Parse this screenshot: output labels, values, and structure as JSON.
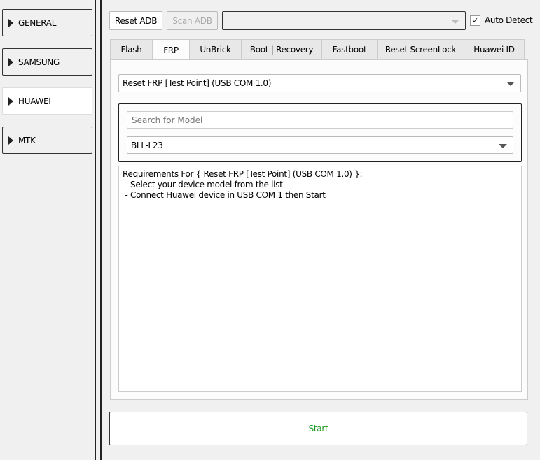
{
  "sidebar": {
    "items": [
      {
        "label": "GENERAL",
        "active": false
      },
      {
        "label": "SAMSUNG",
        "active": false
      },
      {
        "label": "HUAWEI",
        "active": true
      },
      {
        "label": "MTK",
        "active": false
      }
    ]
  },
  "toolbar": {
    "reset_adb": "Reset ADB",
    "scan_adb": "Scan ADB",
    "device_combo": "",
    "auto_detect": "Auto Detect",
    "auto_detect_checked": true
  },
  "tabs": [
    "Flash",
    "FRP",
    "UnBrick",
    "Boot | Recovery",
    "Fastboot",
    "Reset ScreenLock",
    "Huawei ID"
  ],
  "active_tab": "FRP",
  "frp": {
    "operation": "Reset FRP [Test Point] (USB COM 1.0)",
    "search_placeholder": "Search for Model",
    "model": "BLL-L23",
    "requirements": [
      "Requirements For { Reset FRP [Test Point] (USB COM 1.0) }:",
      " - Select your device model from the list",
      " - Connect Huawei device in USB COM 1 then Start"
    ]
  },
  "start_label": "Start",
  "colors": {
    "start_text": "#1a9a1a"
  }
}
